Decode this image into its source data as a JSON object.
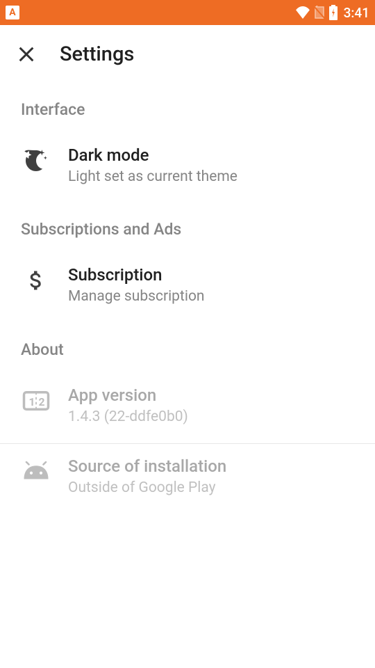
{
  "statusBar": {
    "time": "3:41"
  },
  "appBar": {
    "title": "Settings"
  },
  "sections": {
    "interface": {
      "header": "Interface",
      "darkMode": {
        "title": "Dark mode",
        "subtitle": "Light set as current theme"
      }
    },
    "subscriptions": {
      "header": "Subscriptions and Ads",
      "subscription": {
        "title": "Subscription",
        "subtitle": "Manage subscription"
      }
    },
    "about": {
      "header": "About",
      "appVersion": {
        "title": "App version",
        "subtitle": "1.4.3 (22-ddfe0b0)"
      },
      "sourceInstall": {
        "title": "Source of installation",
        "subtitle": "Outside of Google Play"
      }
    }
  },
  "colors": {
    "accent": "#ee6c24"
  }
}
